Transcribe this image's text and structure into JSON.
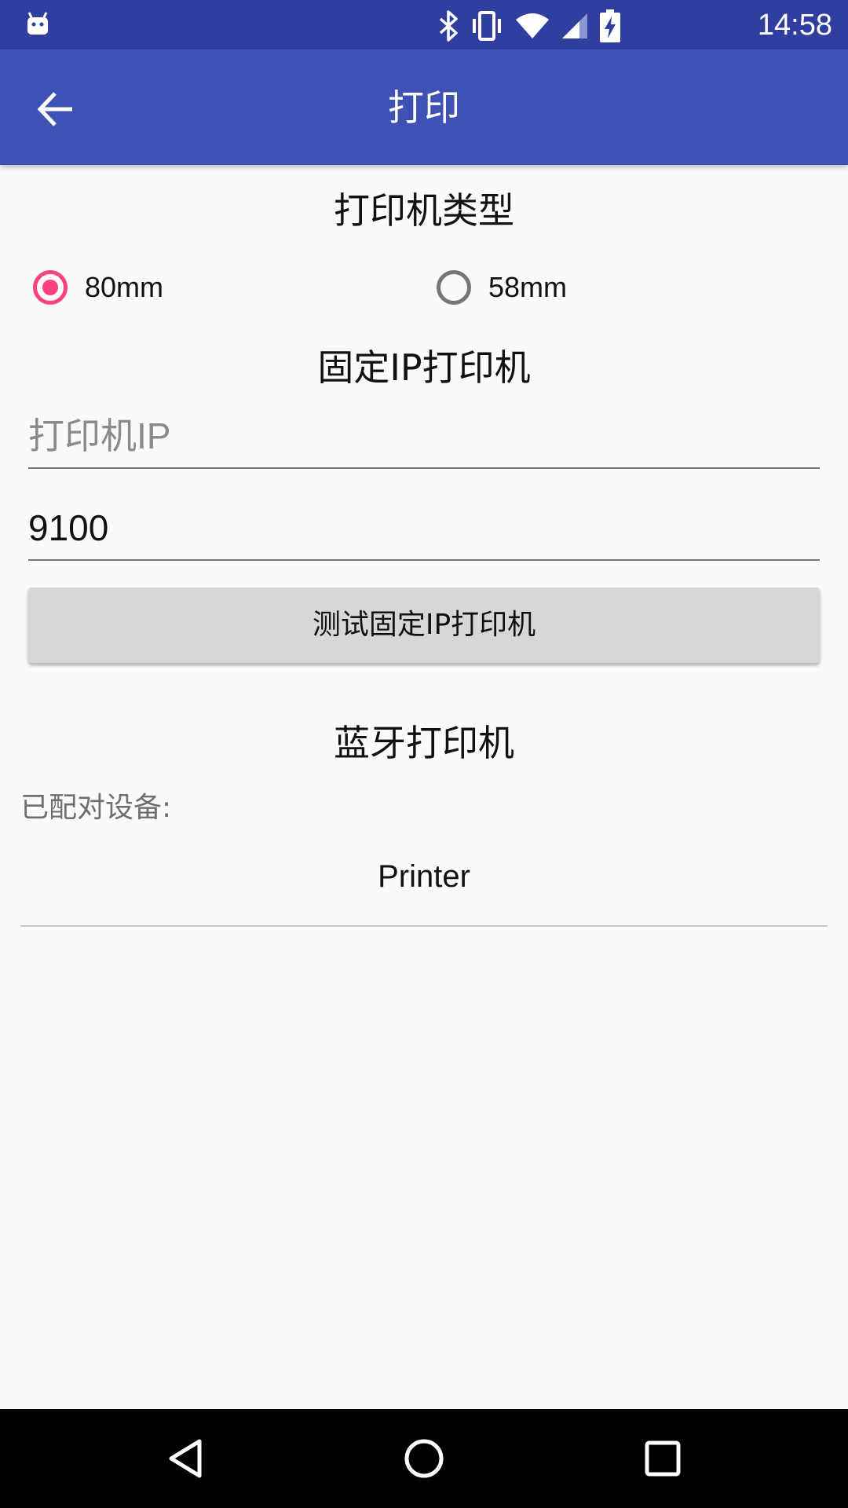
{
  "status_bar": {
    "time": "14:58",
    "icons": [
      "android-icon",
      "bluetooth-icon",
      "vibrate-icon",
      "wifi-icon",
      "signal-icon",
      "battery-charging-icon"
    ]
  },
  "app_bar": {
    "title": "打印",
    "back_icon": "arrow-back-icon"
  },
  "printer_type": {
    "title": "打印机类型",
    "options": [
      {
        "label": "80mm",
        "checked": true
      },
      {
        "label": "58mm",
        "checked": false
      }
    ]
  },
  "fixed_ip": {
    "title": "固定IP打印机",
    "ip_placeholder": "打印机IP",
    "ip_value": "",
    "port_value": "9100",
    "test_button_label": "测试固定IP打印机"
  },
  "bluetooth": {
    "title": "蓝牙打印机",
    "paired_label": "已配对设备:",
    "devices": [
      "Printer"
    ]
  },
  "nav_bar": {
    "buttons": [
      "back-triangle-icon",
      "home-circle-icon",
      "recents-square-icon"
    ]
  },
  "colors": {
    "status_bar": "#303f9f",
    "app_bar": "#3f51b5",
    "accent": "#ff4081",
    "background": "#fafafa"
  }
}
